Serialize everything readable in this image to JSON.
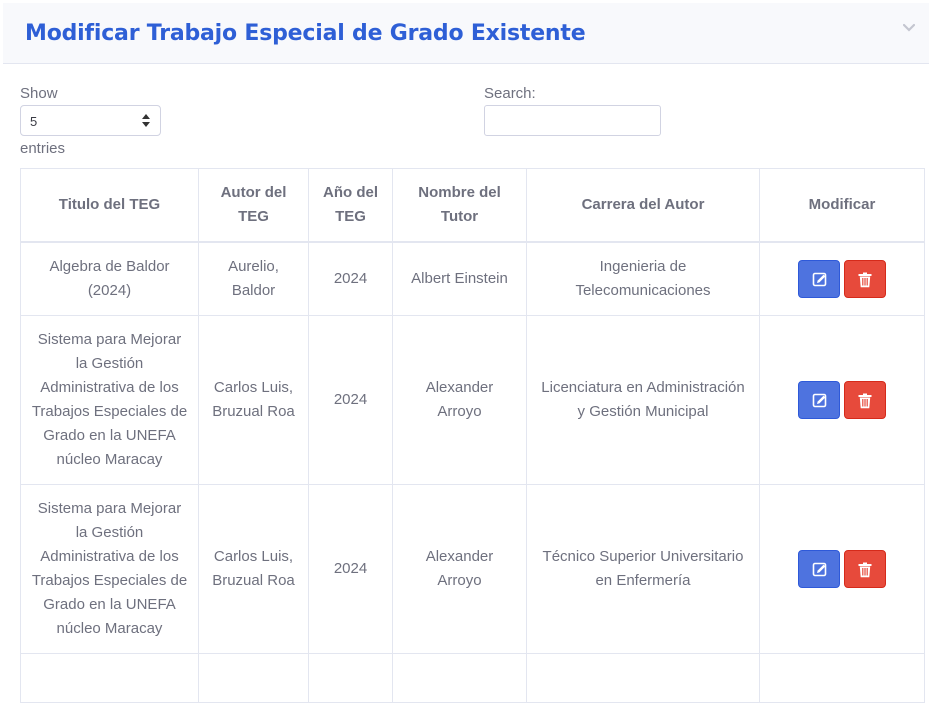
{
  "header": {
    "title": "Modificar Trabajo Especial de Grado Existente"
  },
  "length_menu": {
    "show_label": "Show",
    "selected": "5",
    "entries_label": "entries"
  },
  "search": {
    "label": "Search:",
    "value": ""
  },
  "table": {
    "columns": [
      "Titulo del TEG",
      "Autor del TEG",
      "Año del TEG",
      "Nombre del Tutor",
      "Carrera del Autor",
      "Modificar"
    ],
    "rows": [
      {
        "titulo": "Algebra de Baldor (2024)",
        "autor": "Aurelio, Baldor",
        "anio": "2024",
        "tutor": "Albert Einstein",
        "carrera": "Ingenieria de Telecomunicaciones"
      },
      {
        "titulo": "Sistema para Mejorar la Gestión Administrativa de los Trabajos Especiales de Grado en la UNEFA núcleo Maracay",
        "autor": "Carlos Luis, Bruzual Roa",
        "anio": "2024",
        "tutor": "Alexander Arroyo",
        "carrera": "Licenciatura en Administración y Gestión Municipal"
      },
      {
        "titulo": "Sistema para Mejorar la Gestión Administrativa de los Trabajos Especiales de Grado en la UNEFA núcleo Maracay",
        "autor": "Carlos Luis, Bruzual Roa",
        "anio": "2024",
        "tutor": "Alexander Arroyo",
        "carrera": "Técnico Superior Universitario en Enfermería"
      },
      {
        "titulo": "",
        "autor": "",
        "anio": "",
        "tutor": "",
        "carrera": ""
      }
    ]
  },
  "icons": {
    "edit": "edit-icon",
    "delete": "trash-icon",
    "collapse": "chevron-down-icon"
  },
  "colors": {
    "title": "#2e5fd6",
    "edit_button": "#4e73df",
    "delete_button": "#e74a3b"
  }
}
